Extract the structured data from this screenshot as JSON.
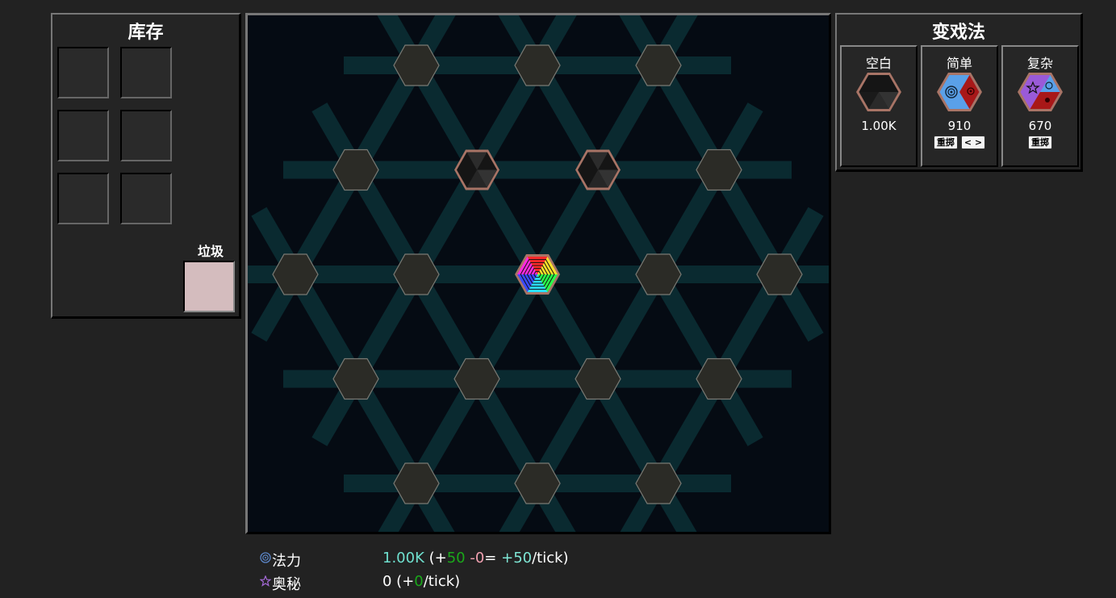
{
  "inventory": {
    "title": "库存",
    "slots": [
      {
        "item": null
      },
      {
        "item": null
      },
      {
        "item": null
      },
      {
        "item": null
      },
      {
        "item": null
      },
      {
        "item": null
      }
    ],
    "trash_label": "垃圾"
  },
  "board": {
    "background_color": "#050b13",
    "line_color": "#0a2a30",
    "empty_cell_color": "#2b2b26",
    "cells": [
      {
        "row": 0,
        "col": 0,
        "type": "empty"
      },
      {
        "row": 0,
        "col": 1,
        "type": "empty"
      },
      {
        "row": 0,
        "col": 2,
        "type": "empty"
      },
      {
        "row": 1,
        "col": 0,
        "type": "empty"
      },
      {
        "row": 1,
        "col": 1,
        "type": "blank-transform"
      },
      {
        "row": 1,
        "col": 2,
        "type": "blank-transform"
      },
      {
        "row": 1,
        "col": 3,
        "type": "empty"
      },
      {
        "row": 2,
        "col": 0,
        "type": "empty"
      },
      {
        "row": 2,
        "col": 1,
        "type": "empty"
      },
      {
        "row": 2,
        "col": 2,
        "type": "rainbow-core"
      },
      {
        "row": 2,
        "col": 3,
        "type": "empty"
      },
      {
        "row": 2,
        "col": 4,
        "type": "empty"
      },
      {
        "row": 3,
        "col": 0,
        "type": "empty"
      },
      {
        "row": 3,
        "col": 1,
        "type": "empty"
      },
      {
        "row": 3,
        "col": 2,
        "type": "empty"
      },
      {
        "row": 3,
        "col": 3,
        "type": "empty"
      },
      {
        "row": 4,
        "col": 0,
        "type": "empty"
      },
      {
        "row": 4,
        "col": 1,
        "type": "empty"
      },
      {
        "row": 4,
        "col": 2,
        "type": "empty"
      }
    ]
  },
  "transforms": {
    "title": "变戏法",
    "cards": [
      {
        "name": "空白",
        "value": "1.00K",
        "icon": "blank-hex-icon",
        "buttons": []
      },
      {
        "name": "简单",
        "value": "910",
        "icon": "simple-hex-icon",
        "buttons": [
          "重掷",
          "< >"
        ]
      },
      {
        "name": "复杂",
        "value": "670",
        "icon": "complex-hex-icon",
        "buttons": [
          "重掷"
        ]
      }
    ]
  },
  "resources": {
    "mana": {
      "icon": "mana-swirl-icon",
      "name": "法力",
      "amount": "1.00K",
      "open": " (+",
      "gain": "50",
      "minus": " -0",
      "eq": "= ",
      "net": "+50",
      "unit": "/tick)"
    },
    "arcane": {
      "icon": "arcane-star-icon",
      "name": "奥秘",
      "amount": "0",
      "open": " (+",
      "gain": "0",
      "unit": "/tick)"
    }
  }
}
